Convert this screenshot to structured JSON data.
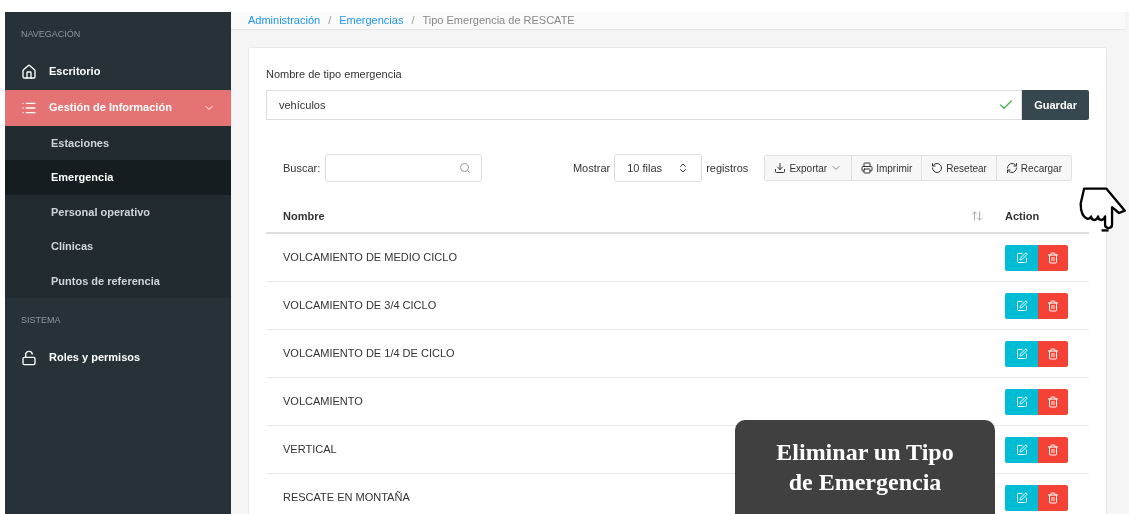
{
  "sidebar": {
    "sections": [
      {
        "title": "NAVEGACIÓN",
        "items": [
          {
            "label": "Escritorio",
            "selected": false
          },
          {
            "label": "Gestión de Información",
            "selected": true,
            "expanded": true,
            "children": [
              {
                "label": "Estaciones",
                "selected": false
              },
              {
                "label": "Emergencia",
                "selected": true
              },
              {
                "label": "Personal operativo",
                "selected": false
              },
              {
                "label": "Clínicas",
                "selected": false
              },
              {
                "label": "Puntos de referencia",
                "selected": false
              }
            ]
          }
        ]
      },
      {
        "title": "SISTEMA",
        "items": [
          {
            "label": "Roles y permisos",
            "selected": false
          }
        ]
      }
    ]
  },
  "breadcrumb": [
    {
      "kind": "link",
      "label": "Administración"
    },
    {
      "kind": "separator",
      "label": "/"
    },
    {
      "kind": "link",
      "label": "Emergencias"
    },
    {
      "kind": "separator",
      "label": "/"
    },
    {
      "kind": "current",
      "label": "Tipo Emergencia de RESCATE"
    }
  ],
  "form": {
    "label": "Nombre de tipo emergencia",
    "value": "vehículos",
    "valid": true,
    "button": "Guardar"
  },
  "toolbar": {
    "search_label": "Buscar:",
    "show_label": "Mostrar",
    "rows_select": "10 filas",
    "records_label": "registros",
    "buttons": [
      {
        "label": "Exportar",
        "dropdown": true
      },
      {
        "label": "Imprimir",
        "dropdown": false
      },
      {
        "label": "Resetear",
        "dropdown": false
      },
      {
        "label": "Recargar",
        "dropdown": false
      }
    ]
  },
  "table": {
    "columns": [
      "Nombre",
      "Action"
    ],
    "rows": [
      {
        "name": "VOLCAMIENTO DE MEDIO CICLO"
      },
      {
        "name": "VOLCAMIENTO DE 3/4 CICLO"
      },
      {
        "name": "VOLCAMIENTO DE 1/4 DE CICLO"
      },
      {
        "name": "VOLCAMIENTO"
      },
      {
        "name": "VERTICAL"
      },
      {
        "name": "RESCATE EN MONTAÑA"
      }
    ]
  },
  "banner": {
    "text": "Eliminar un Tipo de Emergencia"
  }
}
